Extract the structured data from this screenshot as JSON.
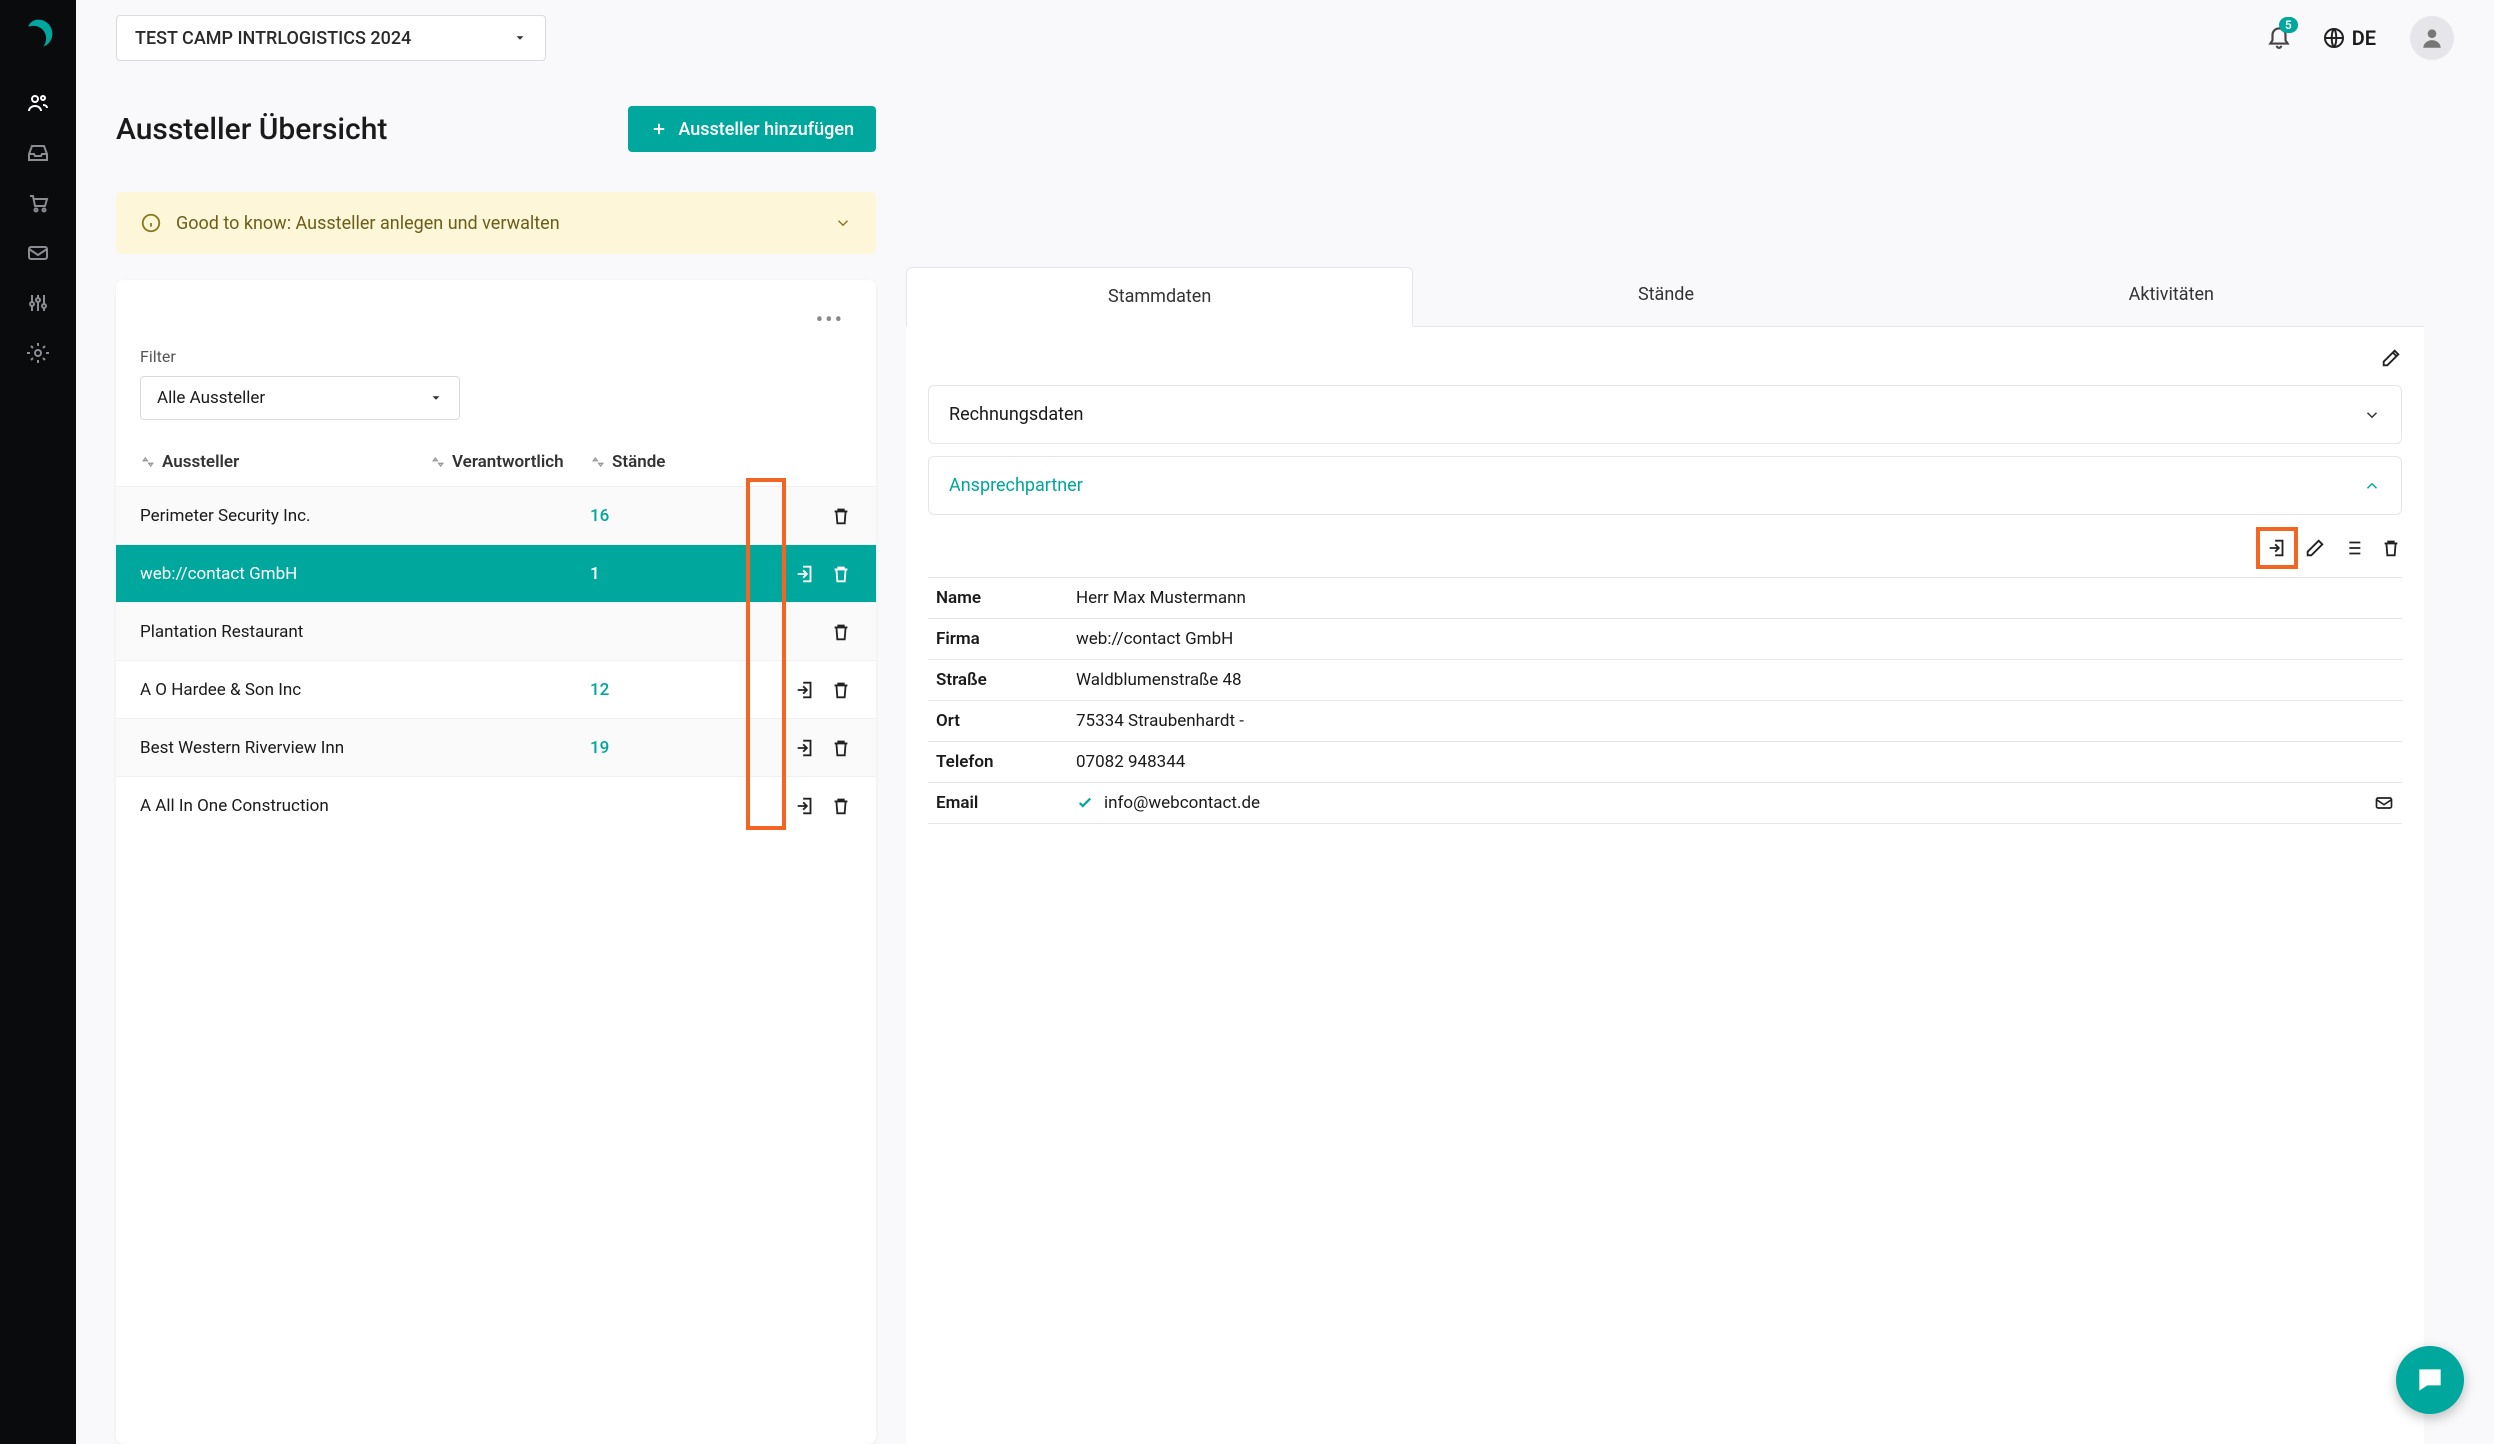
{
  "header": {
    "camp": "TEST CAMP INTRLOGISTICS 2024",
    "lang": "DE",
    "notifications": "5"
  },
  "page": {
    "title": "Aussteller Übersicht",
    "add_button": "Aussteller hinzufügen",
    "alert": "Good to know: Aussteller anlegen und verwalten"
  },
  "filter": {
    "label": "Filter",
    "selected": "Alle Aussteller"
  },
  "columns": {
    "aussteller": "Aussteller",
    "verantwortlich": "Verantwortlich",
    "staende": "Stände"
  },
  "rows": [
    {
      "name": "Perimeter Security Inc.",
      "staende": "16",
      "enter": false
    },
    {
      "name": "web://contact GmbH",
      "staende": "1",
      "enter": true,
      "selected": true
    },
    {
      "name": "Plantation Restaurant",
      "staende": "",
      "enter": false
    },
    {
      "name": "A O Hardee & Son Inc",
      "staende": "12",
      "enter": true
    },
    {
      "name": "Best Western Riverview Inn",
      "staende": "19",
      "enter": true
    },
    {
      "name": "A All In One Construction",
      "staende": "",
      "enter": true
    }
  ],
  "detail": {
    "tabs": {
      "stamm": "Stammdaten",
      "staende": "Stände",
      "aktiv": "Aktivitäten"
    },
    "sections": {
      "rechnung": "Rechnungsdaten",
      "ansprech": "Ansprechpartner"
    },
    "contact": {
      "labels": {
        "name": "Name",
        "firma": "Firma",
        "strasse": "Straße",
        "ort": "Ort",
        "telefon": "Telefon",
        "email": "Email"
      },
      "name": "Herr Max Mustermann",
      "firma": "web://contact GmbH",
      "strasse": "Waldblumenstraße 48",
      "ort": "75334 Straubenhardt -",
      "telefon": "07082 948344",
      "email": "info@webcontact.de"
    }
  }
}
